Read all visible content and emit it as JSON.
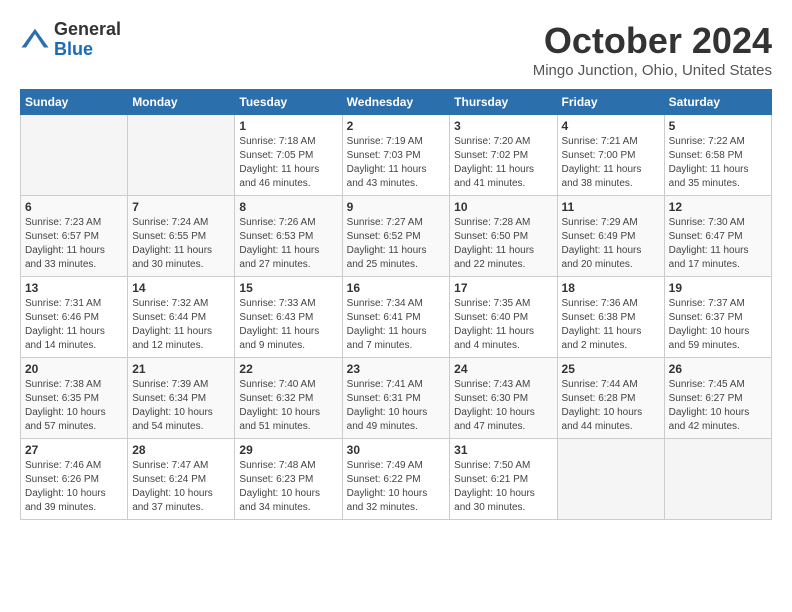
{
  "logo": {
    "general": "General",
    "blue": "Blue"
  },
  "title": "October 2024",
  "location": "Mingo Junction, Ohio, United States",
  "weekdays": [
    "Sunday",
    "Monday",
    "Tuesday",
    "Wednesday",
    "Thursday",
    "Friday",
    "Saturday"
  ],
  "weeks": [
    [
      {
        "day": "",
        "sunrise": "",
        "sunset": "",
        "daylight": ""
      },
      {
        "day": "",
        "sunrise": "",
        "sunset": "",
        "daylight": ""
      },
      {
        "day": "1",
        "sunrise": "Sunrise: 7:18 AM",
        "sunset": "Sunset: 7:05 PM",
        "daylight": "Daylight: 11 hours and 46 minutes."
      },
      {
        "day": "2",
        "sunrise": "Sunrise: 7:19 AM",
        "sunset": "Sunset: 7:03 PM",
        "daylight": "Daylight: 11 hours and 43 minutes."
      },
      {
        "day": "3",
        "sunrise": "Sunrise: 7:20 AM",
        "sunset": "Sunset: 7:02 PM",
        "daylight": "Daylight: 11 hours and 41 minutes."
      },
      {
        "day": "4",
        "sunrise": "Sunrise: 7:21 AM",
        "sunset": "Sunset: 7:00 PM",
        "daylight": "Daylight: 11 hours and 38 minutes."
      },
      {
        "day": "5",
        "sunrise": "Sunrise: 7:22 AM",
        "sunset": "Sunset: 6:58 PM",
        "daylight": "Daylight: 11 hours and 35 minutes."
      }
    ],
    [
      {
        "day": "6",
        "sunrise": "Sunrise: 7:23 AM",
        "sunset": "Sunset: 6:57 PM",
        "daylight": "Daylight: 11 hours and 33 minutes."
      },
      {
        "day": "7",
        "sunrise": "Sunrise: 7:24 AM",
        "sunset": "Sunset: 6:55 PM",
        "daylight": "Daylight: 11 hours and 30 minutes."
      },
      {
        "day": "8",
        "sunrise": "Sunrise: 7:26 AM",
        "sunset": "Sunset: 6:53 PM",
        "daylight": "Daylight: 11 hours and 27 minutes."
      },
      {
        "day": "9",
        "sunrise": "Sunrise: 7:27 AM",
        "sunset": "Sunset: 6:52 PM",
        "daylight": "Daylight: 11 hours and 25 minutes."
      },
      {
        "day": "10",
        "sunrise": "Sunrise: 7:28 AM",
        "sunset": "Sunset: 6:50 PM",
        "daylight": "Daylight: 11 hours and 22 minutes."
      },
      {
        "day": "11",
        "sunrise": "Sunrise: 7:29 AM",
        "sunset": "Sunset: 6:49 PM",
        "daylight": "Daylight: 11 hours and 20 minutes."
      },
      {
        "day": "12",
        "sunrise": "Sunrise: 7:30 AM",
        "sunset": "Sunset: 6:47 PM",
        "daylight": "Daylight: 11 hours and 17 minutes."
      }
    ],
    [
      {
        "day": "13",
        "sunrise": "Sunrise: 7:31 AM",
        "sunset": "Sunset: 6:46 PM",
        "daylight": "Daylight: 11 hours and 14 minutes."
      },
      {
        "day": "14",
        "sunrise": "Sunrise: 7:32 AM",
        "sunset": "Sunset: 6:44 PM",
        "daylight": "Daylight: 11 hours and 12 minutes."
      },
      {
        "day": "15",
        "sunrise": "Sunrise: 7:33 AM",
        "sunset": "Sunset: 6:43 PM",
        "daylight": "Daylight: 11 hours and 9 minutes."
      },
      {
        "day": "16",
        "sunrise": "Sunrise: 7:34 AM",
        "sunset": "Sunset: 6:41 PM",
        "daylight": "Daylight: 11 hours and 7 minutes."
      },
      {
        "day": "17",
        "sunrise": "Sunrise: 7:35 AM",
        "sunset": "Sunset: 6:40 PM",
        "daylight": "Daylight: 11 hours and 4 minutes."
      },
      {
        "day": "18",
        "sunrise": "Sunrise: 7:36 AM",
        "sunset": "Sunset: 6:38 PM",
        "daylight": "Daylight: 11 hours and 2 minutes."
      },
      {
        "day": "19",
        "sunrise": "Sunrise: 7:37 AM",
        "sunset": "Sunset: 6:37 PM",
        "daylight": "Daylight: 10 hours and 59 minutes."
      }
    ],
    [
      {
        "day": "20",
        "sunrise": "Sunrise: 7:38 AM",
        "sunset": "Sunset: 6:35 PM",
        "daylight": "Daylight: 10 hours and 57 minutes."
      },
      {
        "day": "21",
        "sunrise": "Sunrise: 7:39 AM",
        "sunset": "Sunset: 6:34 PM",
        "daylight": "Daylight: 10 hours and 54 minutes."
      },
      {
        "day": "22",
        "sunrise": "Sunrise: 7:40 AM",
        "sunset": "Sunset: 6:32 PM",
        "daylight": "Daylight: 10 hours and 51 minutes."
      },
      {
        "day": "23",
        "sunrise": "Sunrise: 7:41 AM",
        "sunset": "Sunset: 6:31 PM",
        "daylight": "Daylight: 10 hours and 49 minutes."
      },
      {
        "day": "24",
        "sunrise": "Sunrise: 7:43 AM",
        "sunset": "Sunset: 6:30 PM",
        "daylight": "Daylight: 10 hours and 47 minutes."
      },
      {
        "day": "25",
        "sunrise": "Sunrise: 7:44 AM",
        "sunset": "Sunset: 6:28 PM",
        "daylight": "Daylight: 10 hours and 44 minutes."
      },
      {
        "day": "26",
        "sunrise": "Sunrise: 7:45 AM",
        "sunset": "Sunset: 6:27 PM",
        "daylight": "Daylight: 10 hours and 42 minutes."
      }
    ],
    [
      {
        "day": "27",
        "sunrise": "Sunrise: 7:46 AM",
        "sunset": "Sunset: 6:26 PM",
        "daylight": "Daylight: 10 hours and 39 minutes."
      },
      {
        "day": "28",
        "sunrise": "Sunrise: 7:47 AM",
        "sunset": "Sunset: 6:24 PM",
        "daylight": "Daylight: 10 hours and 37 minutes."
      },
      {
        "day": "29",
        "sunrise": "Sunrise: 7:48 AM",
        "sunset": "Sunset: 6:23 PM",
        "daylight": "Daylight: 10 hours and 34 minutes."
      },
      {
        "day": "30",
        "sunrise": "Sunrise: 7:49 AM",
        "sunset": "Sunset: 6:22 PM",
        "daylight": "Daylight: 10 hours and 32 minutes."
      },
      {
        "day": "31",
        "sunrise": "Sunrise: 7:50 AM",
        "sunset": "Sunset: 6:21 PM",
        "daylight": "Daylight: 10 hours and 30 minutes."
      },
      {
        "day": "",
        "sunrise": "",
        "sunset": "",
        "daylight": ""
      },
      {
        "day": "",
        "sunrise": "",
        "sunset": "",
        "daylight": ""
      }
    ]
  ]
}
